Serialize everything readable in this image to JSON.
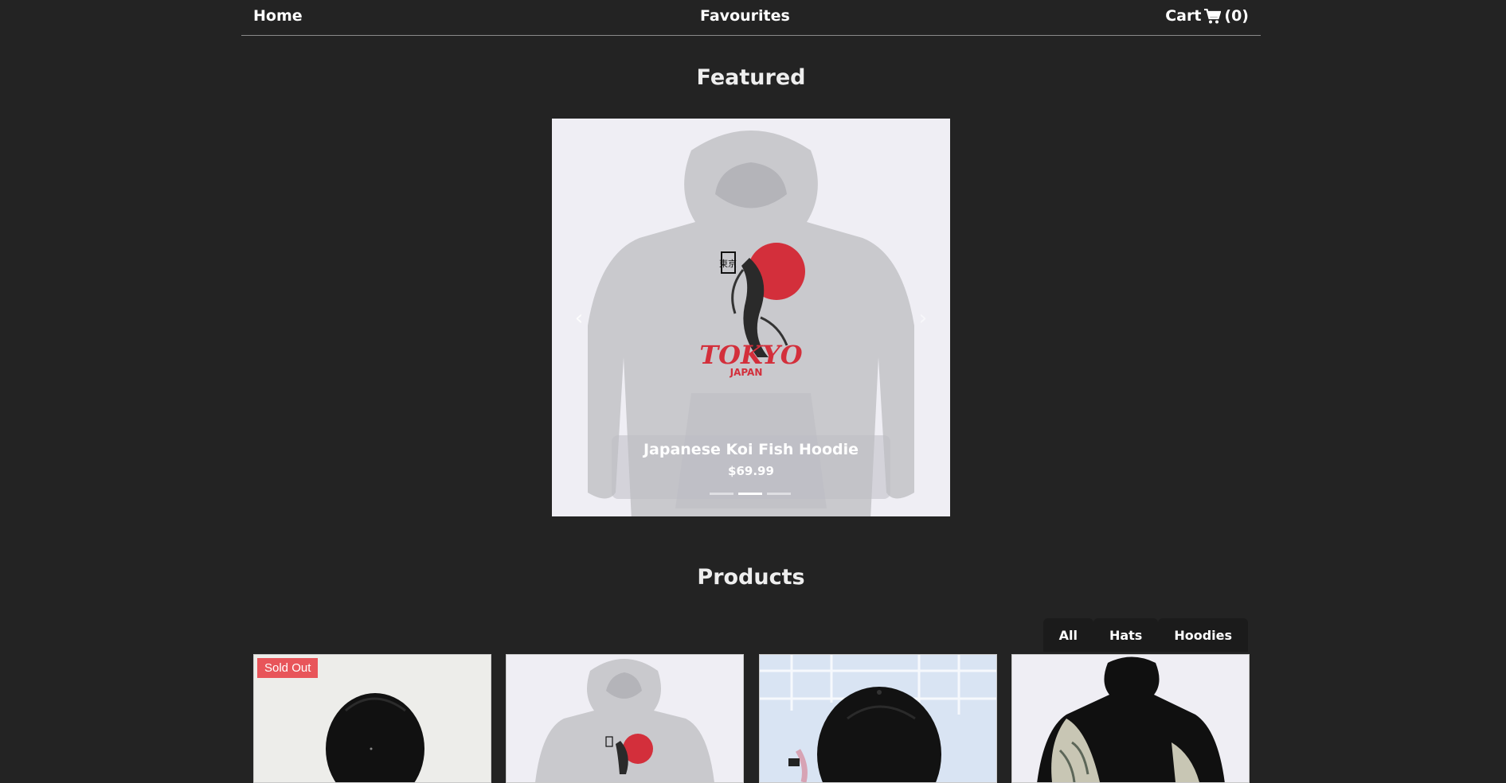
{
  "nav": {
    "home": "Home",
    "favourites": "Favourites",
    "cart_label": "Cart",
    "cart_count": "(0)"
  },
  "featured": {
    "heading": "Featured",
    "slide": {
      "name": "Japanese Koi Fish Hoodie",
      "price": "$69.99",
      "print_text": "TOKYO",
      "print_sub": "JAPAN",
      "kanji": "東京"
    },
    "indicators": 3,
    "active_indicator": 2
  },
  "products": {
    "heading": "Products",
    "filters": [
      "All",
      "Hats",
      "Hoodies"
    ],
    "items": [
      {
        "type": "hat",
        "badge": "Sold Out"
      },
      {
        "type": "hoodie"
      },
      {
        "type": "hat"
      },
      {
        "type": "hoodie"
      }
    ]
  },
  "colors": {
    "background": "#232323",
    "badge": "#e8555a",
    "koi_red": "#d32f3b"
  }
}
